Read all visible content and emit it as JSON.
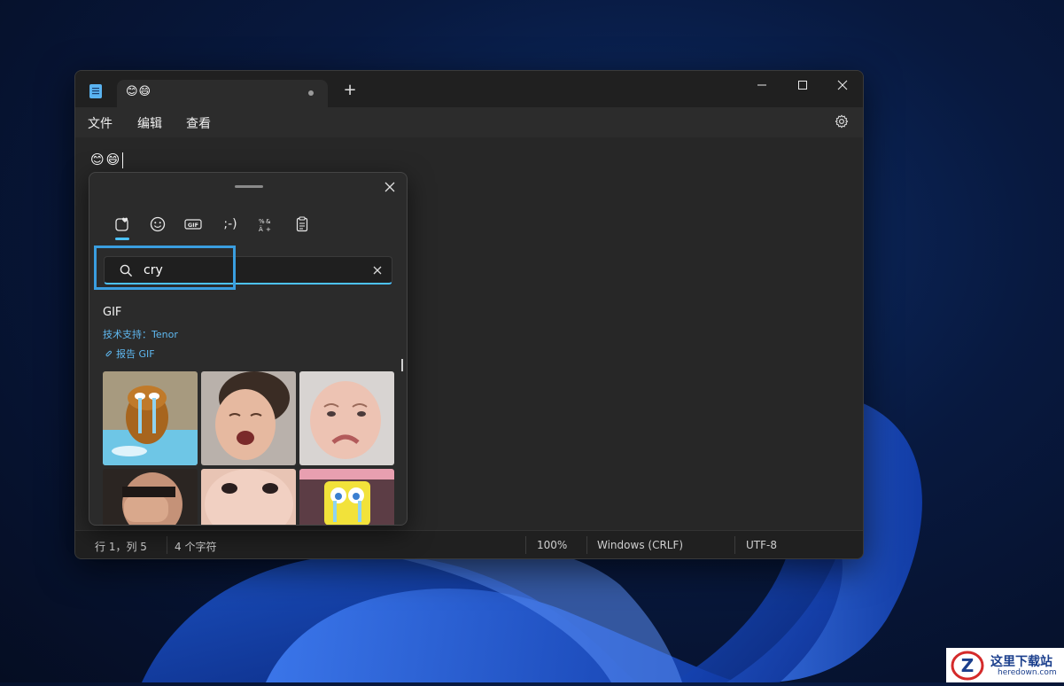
{
  "window": {
    "tab_title": "😊😄",
    "new_tab_icon": "plus-icon",
    "controls": [
      "minimize-icon",
      "maximize-icon",
      "close-icon"
    ]
  },
  "menu": {
    "file": "文件",
    "edit": "编辑",
    "view": "查看",
    "settings_icon": "gear-icon"
  },
  "editor": {
    "content": "😊😄"
  },
  "status": {
    "position": "行 1，列 5",
    "chars": "4 个字符",
    "zoom": "100%",
    "line_ending": "Windows (CRLF)",
    "encoding": "UTF-8"
  },
  "emoji_panel": {
    "tabs": [
      {
        "name": "recent-favorites-icon",
        "active": true
      },
      {
        "name": "emoji-icon",
        "active": false
      },
      {
        "name": "gif-icon",
        "active": false
      },
      {
        "name": "kaomoji-icon",
        "label": ";-)",
        "active": false
      },
      {
        "name": "symbols-icon",
        "active": false
      },
      {
        "name": "clipboard-icon",
        "active": false
      }
    ],
    "gif_tab_label": "GIF",
    "search": {
      "value": "cry",
      "placeholder": ""
    },
    "section_title": "GIF",
    "powered_by": "技术支持：Tenor",
    "report": "报告 GIF",
    "accent": "#4cc2ff"
  },
  "watermark": {
    "text": "这里下载站",
    "sub": "heredown.com"
  }
}
